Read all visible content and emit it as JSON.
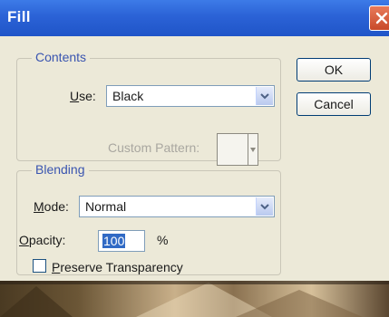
{
  "window": {
    "title": "Fill"
  },
  "contents": {
    "legend": "Contents",
    "use_label_prefix": "",
    "use_label_underlined": "U",
    "use_label_rest": "se:",
    "use_value": "Black",
    "custom_pattern_label": "Custom Pattern:"
  },
  "blending": {
    "legend": "Blending",
    "mode_label_underlined": "M",
    "mode_label_rest": "ode:",
    "mode_value": "Normal",
    "opacity_label_underlined": "O",
    "opacity_label_rest": "pacity:",
    "opacity_value": "100",
    "opacity_unit": "%",
    "preserve_underlined": "P",
    "preserve_rest": "reserve Transparency",
    "preserve_checked": false
  },
  "buttons": {
    "ok": "OK",
    "cancel_underlined": "",
    "cancel": "Cancel"
  },
  "icons": {
    "close": "close-icon",
    "dropdown": "chevron-down-icon"
  },
  "colors": {
    "titlebar": "#2b62d6",
    "legend_text": "#3a55b0",
    "selection": "#316ac5",
    "dialog_bg": "#ece9d8"
  }
}
